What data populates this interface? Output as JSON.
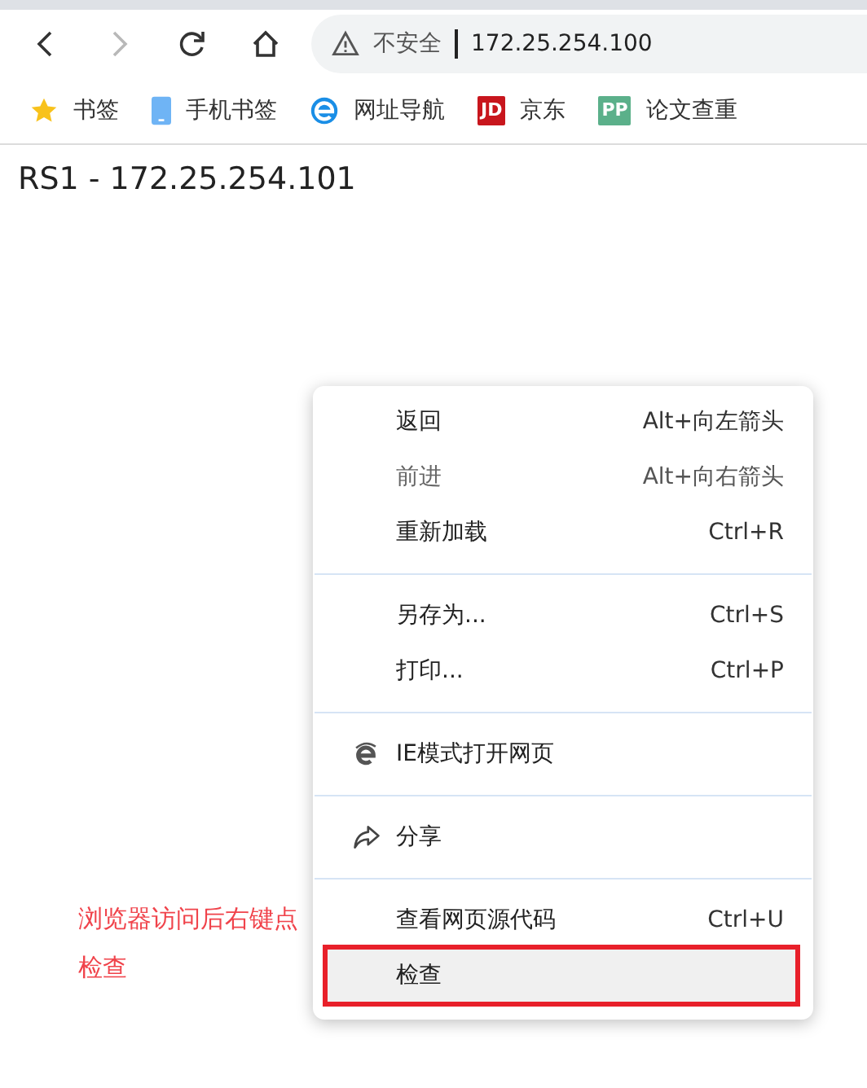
{
  "toolbar": {
    "security_label": "不安全",
    "address": "172.25.254.100",
    "forward_disabled": true
  },
  "bookmarks": [
    {
      "kind": "star",
      "label": "书签"
    },
    {
      "kind": "phone",
      "label": "手机书签"
    },
    {
      "kind": "e",
      "label": "网址导航"
    },
    {
      "kind": "jd",
      "label": "京东",
      "icon_text": "JD"
    },
    {
      "kind": "pp",
      "label": "论文查重",
      "icon_text": "PP"
    }
  ],
  "page": {
    "heading": "RS1 - 172.25.254.101"
  },
  "context_menu": {
    "groups": [
      [
        {
          "label": "返回",
          "shortcut": "Alt+向左箭头",
          "disabled": false,
          "selected": false
        },
        {
          "label": "前进",
          "shortcut": "Alt+向右箭头",
          "disabled": true,
          "selected": false
        },
        {
          "label": "重新加载",
          "shortcut": "Ctrl+R",
          "disabled": false,
          "selected": false
        }
      ],
      [
        {
          "label": "另存为...",
          "shortcut": "Ctrl+S",
          "disabled": false,
          "selected": false
        },
        {
          "label": "打印...",
          "shortcut": "Ctrl+P",
          "disabled": false,
          "selected": false
        }
      ],
      [
        {
          "label": "IE模式打开网页",
          "kind": "ie",
          "disabled": false,
          "selected": false
        }
      ],
      [
        {
          "label": "分享",
          "kind": "share",
          "disabled": false,
          "selected": false
        }
      ],
      [
        {
          "label": "查看网页源代码",
          "shortcut": "Ctrl+U",
          "disabled": false,
          "selected": false
        },
        {
          "label": "检查",
          "disabled": false,
          "selected": true,
          "highlighted": true
        }
      ]
    ]
  },
  "annotation": {
    "text": "浏览器访问后右键点检查"
  }
}
